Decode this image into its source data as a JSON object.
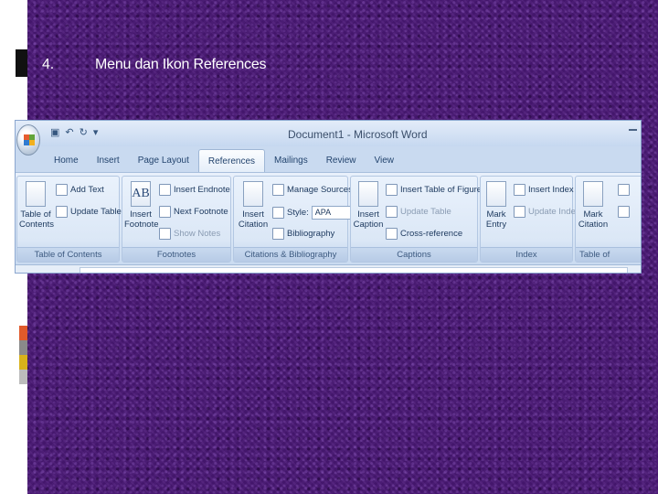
{
  "slide": {
    "number": "4.",
    "title": "Menu dan Ikon References"
  },
  "window": {
    "title": "Document1 - Microsoft Word"
  },
  "tabs": [
    "Home",
    "Insert",
    "Page Layout",
    "References",
    "Mailings",
    "Review",
    "View"
  ],
  "active_tab": "References",
  "groups": {
    "toc": {
      "label": "Table of Contents",
      "big_label": "Table of Contents",
      "add_text": "Add Text",
      "update_table": "Update Table"
    },
    "footnotes": {
      "label": "Footnotes",
      "big_label": "Insert Footnote",
      "insert_endnote": "Insert Endnote",
      "next_footnote": "Next Footnote",
      "show_notes": "Show Notes"
    },
    "citations": {
      "label": "Citations & Bibliography",
      "big_label": "Insert Citation",
      "manage_sources": "Manage Sources",
      "style_label": "Style:",
      "style_value": "APA",
      "bibliography": "Bibliography"
    },
    "captions": {
      "label": "Captions",
      "big_label": "Insert Caption",
      "insert_tof": "Insert Table of Figures",
      "update_table": "Update Table",
      "cross_reference": "Cross-reference"
    },
    "index": {
      "label": "Index",
      "big_label": "Mark Entry",
      "insert_index": "Insert Index",
      "update_index": "Update Index"
    },
    "toa": {
      "label": "Table of Authorities",
      "big_label": "Mark Citation"
    }
  },
  "colors": {
    "background": "#4a1876",
    "ribbon": "#dce8f7",
    "text": "#ffffff"
  }
}
